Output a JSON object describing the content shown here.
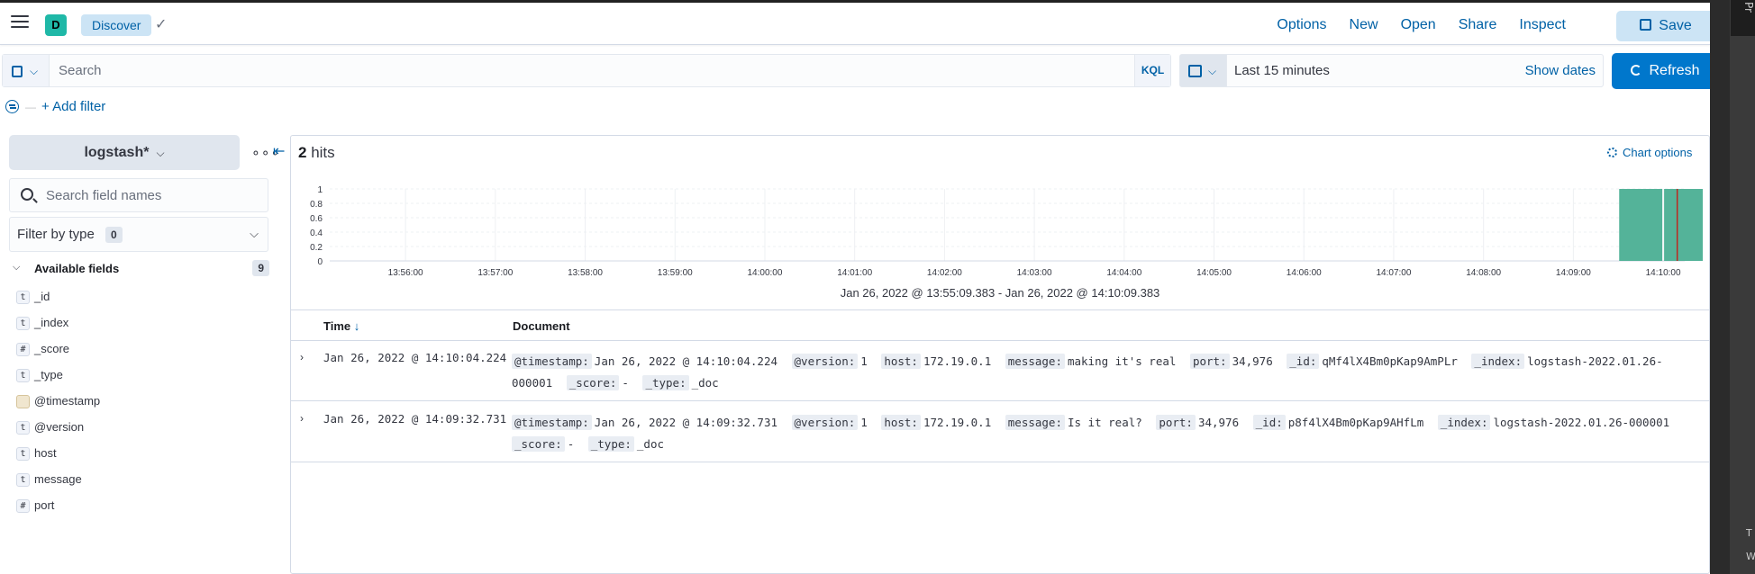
{
  "header": {
    "space_initial": "D",
    "breadcrumb": "Discover",
    "links": [
      "Options",
      "New",
      "Open",
      "Share",
      "Inspect"
    ],
    "save_label": "Save"
  },
  "query": {
    "placeholder": "Search",
    "language": "KQL"
  },
  "date": {
    "range": "Last 15 minutes",
    "show_dates": "Show dates",
    "refresh_label": "Refresh"
  },
  "filters": {
    "add_filter": "+ Add filter"
  },
  "sidebar": {
    "index_pattern": "logstash*",
    "search_placeholder": "Search field names",
    "filter_by_type": "Filter by type",
    "filter_count": "0",
    "available_label": "Available fields",
    "available_count": "9",
    "fields": [
      {
        "type": "t",
        "name": "_id"
      },
      {
        "type": "t",
        "name": "_index"
      },
      {
        "type": "#",
        "name": "_score"
      },
      {
        "type": "t",
        "name": "_type"
      },
      {
        "type": "date",
        "name": "@timestamp"
      },
      {
        "type": "t",
        "name": "@version"
      },
      {
        "type": "t",
        "name": "host"
      },
      {
        "type": "t",
        "name": "message"
      },
      {
        "type": "#",
        "name": "port"
      }
    ]
  },
  "results": {
    "hits_count": "2",
    "hits_label": "hits",
    "chart_options": "Chart options",
    "range_label": "Jan 26, 2022 @ 13:55:09.383 - Jan 26, 2022 @ 14:10:09.383",
    "col_time": "Time",
    "col_document": "Document",
    "rows": [
      {
        "time": "Jan 26, 2022 @ 14:10:04.224",
        "fields": [
          {
            "k": "@timestamp:",
            "v": "Jan 26, 2022 @ 14:10:04.224"
          },
          {
            "k": "@version:",
            "v": "1"
          },
          {
            "k": "host:",
            "v": "172.19.0.1"
          },
          {
            "k": "message:",
            "v": "making it's real"
          },
          {
            "k": "port:",
            "v": "34,976"
          },
          {
            "k": "_id:",
            "v": "qMf4lX4Bm0pKap9AmPLr"
          },
          {
            "k": "_index:",
            "v": "logstash-2022.01.26-000001"
          },
          {
            "k": "_score:",
            "v": "-"
          },
          {
            "k": "_type:",
            "v": "_doc"
          }
        ]
      },
      {
        "time": "Jan 26, 2022 @ 14:09:32.731",
        "fields": [
          {
            "k": "@timestamp:",
            "v": "Jan 26, 2022 @ 14:09:32.731"
          },
          {
            "k": "@version:",
            "v": "1"
          },
          {
            "k": "host:",
            "v": "172.19.0.1"
          },
          {
            "k": "message:",
            "v": "Is it real?"
          },
          {
            "k": "port:",
            "v": "34,976"
          },
          {
            "k": "_id:",
            "v": "p8f4lX4Bm0pKap9AHfLm"
          },
          {
            "k": "_index:",
            "v": "logstash-2022.01.26-000001"
          },
          {
            "k": "_score:",
            "v": "-"
          },
          {
            "k": "_type:",
            "v": "_doc"
          }
        ]
      }
    ]
  },
  "colors": {
    "accent": "#0077cc",
    "bar": "#54b399",
    "now_marker": "#bd271e"
  },
  "chart_data": {
    "type": "bar",
    "x_ticks": [
      "13:56:00",
      "13:57:00",
      "13:58:00",
      "13:59:00",
      "14:00:00",
      "14:01:00",
      "14:02:00",
      "14:03:00",
      "14:04:00",
      "14:05:00",
      "14:06:00",
      "14:07:00",
      "14:08:00",
      "14:09:00",
      "14:10:00"
    ],
    "y_ticks": [
      "0",
      "0.2",
      "0.4",
      "0.6",
      "0.8",
      "1"
    ],
    "ylim": [
      0,
      1
    ],
    "categories": [
      "14:09:30",
      "14:10:00"
    ],
    "values": [
      1,
      1
    ],
    "now_marker": "14:10:09.383"
  },
  "right_strip": {
    "tab": "Pr",
    "letters": [
      "T",
      "W"
    ]
  }
}
